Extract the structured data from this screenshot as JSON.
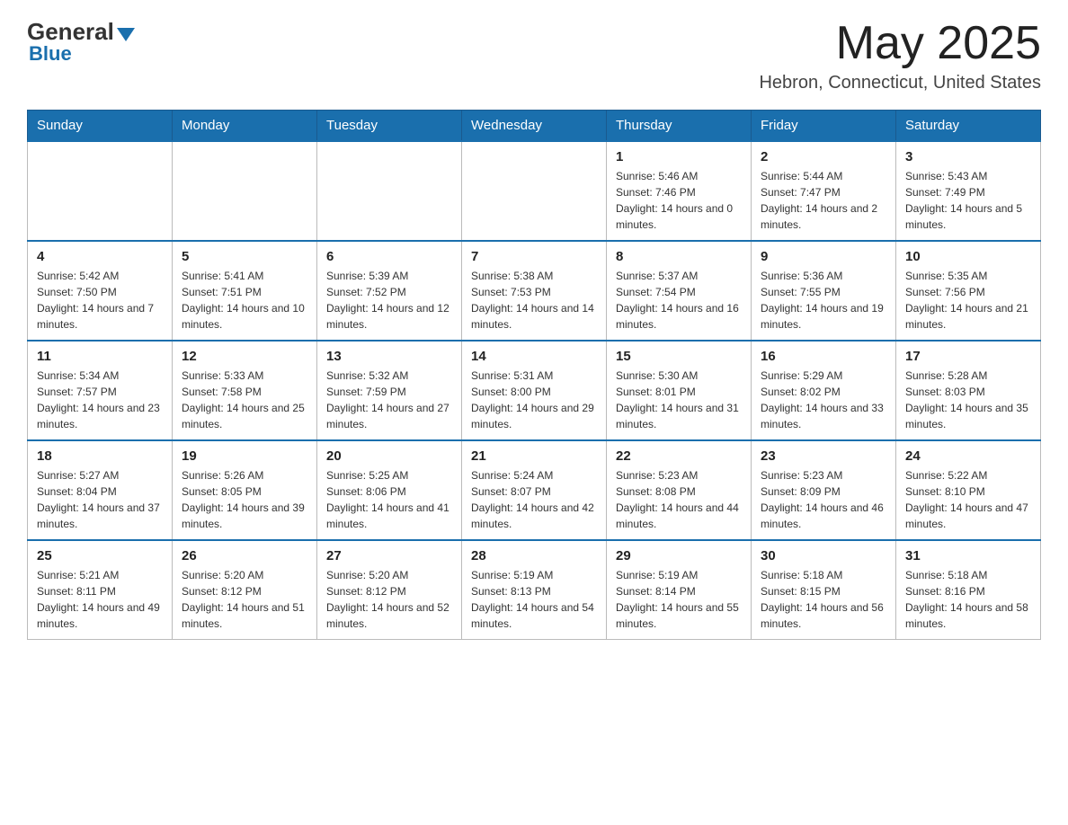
{
  "header": {
    "logo_general": "General",
    "logo_blue": "Blue",
    "logo_subtext": "Blue",
    "title": "May 2025",
    "subtitle": "Hebron, Connecticut, United States"
  },
  "calendar": {
    "days_of_week": [
      "Sunday",
      "Monday",
      "Tuesday",
      "Wednesday",
      "Thursday",
      "Friday",
      "Saturday"
    ],
    "weeks": [
      [
        {
          "day": "",
          "sunrise": "",
          "sunset": "",
          "daylight": ""
        },
        {
          "day": "",
          "sunrise": "",
          "sunset": "",
          "daylight": ""
        },
        {
          "day": "",
          "sunrise": "",
          "sunset": "",
          "daylight": ""
        },
        {
          "day": "",
          "sunrise": "",
          "sunset": "",
          "daylight": ""
        },
        {
          "day": "1",
          "sunrise": "Sunrise: 5:46 AM",
          "sunset": "Sunset: 7:46 PM",
          "daylight": "Daylight: 14 hours and 0 minutes."
        },
        {
          "day": "2",
          "sunrise": "Sunrise: 5:44 AM",
          "sunset": "Sunset: 7:47 PM",
          "daylight": "Daylight: 14 hours and 2 minutes."
        },
        {
          "day": "3",
          "sunrise": "Sunrise: 5:43 AM",
          "sunset": "Sunset: 7:49 PM",
          "daylight": "Daylight: 14 hours and 5 minutes."
        }
      ],
      [
        {
          "day": "4",
          "sunrise": "Sunrise: 5:42 AM",
          "sunset": "Sunset: 7:50 PM",
          "daylight": "Daylight: 14 hours and 7 minutes."
        },
        {
          "day": "5",
          "sunrise": "Sunrise: 5:41 AM",
          "sunset": "Sunset: 7:51 PM",
          "daylight": "Daylight: 14 hours and 10 minutes."
        },
        {
          "day": "6",
          "sunrise": "Sunrise: 5:39 AM",
          "sunset": "Sunset: 7:52 PM",
          "daylight": "Daylight: 14 hours and 12 minutes."
        },
        {
          "day": "7",
          "sunrise": "Sunrise: 5:38 AM",
          "sunset": "Sunset: 7:53 PM",
          "daylight": "Daylight: 14 hours and 14 minutes."
        },
        {
          "day": "8",
          "sunrise": "Sunrise: 5:37 AM",
          "sunset": "Sunset: 7:54 PM",
          "daylight": "Daylight: 14 hours and 16 minutes."
        },
        {
          "day": "9",
          "sunrise": "Sunrise: 5:36 AM",
          "sunset": "Sunset: 7:55 PM",
          "daylight": "Daylight: 14 hours and 19 minutes."
        },
        {
          "day": "10",
          "sunrise": "Sunrise: 5:35 AM",
          "sunset": "Sunset: 7:56 PM",
          "daylight": "Daylight: 14 hours and 21 minutes."
        }
      ],
      [
        {
          "day": "11",
          "sunrise": "Sunrise: 5:34 AM",
          "sunset": "Sunset: 7:57 PM",
          "daylight": "Daylight: 14 hours and 23 minutes."
        },
        {
          "day": "12",
          "sunrise": "Sunrise: 5:33 AM",
          "sunset": "Sunset: 7:58 PM",
          "daylight": "Daylight: 14 hours and 25 minutes."
        },
        {
          "day": "13",
          "sunrise": "Sunrise: 5:32 AM",
          "sunset": "Sunset: 7:59 PM",
          "daylight": "Daylight: 14 hours and 27 minutes."
        },
        {
          "day": "14",
          "sunrise": "Sunrise: 5:31 AM",
          "sunset": "Sunset: 8:00 PM",
          "daylight": "Daylight: 14 hours and 29 minutes."
        },
        {
          "day": "15",
          "sunrise": "Sunrise: 5:30 AM",
          "sunset": "Sunset: 8:01 PM",
          "daylight": "Daylight: 14 hours and 31 minutes."
        },
        {
          "day": "16",
          "sunrise": "Sunrise: 5:29 AM",
          "sunset": "Sunset: 8:02 PM",
          "daylight": "Daylight: 14 hours and 33 minutes."
        },
        {
          "day": "17",
          "sunrise": "Sunrise: 5:28 AM",
          "sunset": "Sunset: 8:03 PM",
          "daylight": "Daylight: 14 hours and 35 minutes."
        }
      ],
      [
        {
          "day": "18",
          "sunrise": "Sunrise: 5:27 AM",
          "sunset": "Sunset: 8:04 PM",
          "daylight": "Daylight: 14 hours and 37 minutes."
        },
        {
          "day": "19",
          "sunrise": "Sunrise: 5:26 AM",
          "sunset": "Sunset: 8:05 PM",
          "daylight": "Daylight: 14 hours and 39 minutes."
        },
        {
          "day": "20",
          "sunrise": "Sunrise: 5:25 AM",
          "sunset": "Sunset: 8:06 PM",
          "daylight": "Daylight: 14 hours and 41 minutes."
        },
        {
          "day": "21",
          "sunrise": "Sunrise: 5:24 AM",
          "sunset": "Sunset: 8:07 PM",
          "daylight": "Daylight: 14 hours and 42 minutes."
        },
        {
          "day": "22",
          "sunrise": "Sunrise: 5:23 AM",
          "sunset": "Sunset: 8:08 PM",
          "daylight": "Daylight: 14 hours and 44 minutes."
        },
        {
          "day": "23",
          "sunrise": "Sunrise: 5:23 AM",
          "sunset": "Sunset: 8:09 PM",
          "daylight": "Daylight: 14 hours and 46 minutes."
        },
        {
          "day": "24",
          "sunrise": "Sunrise: 5:22 AM",
          "sunset": "Sunset: 8:10 PM",
          "daylight": "Daylight: 14 hours and 47 minutes."
        }
      ],
      [
        {
          "day": "25",
          "sunrise": "Sunrise: 5:21 AM",
          "sunset": "Sunset: 8:11 PM",
          "daylight": "Daylight: 14 hours and 49 minutes."
        },
        {
          "day": "26",
          "sunrise": "Sunrise: 5:20 AM",
          "sunset": "Sunset: 8:12 PM",
          "daylight": "Daylight: 14 hours and 51 minutes."
        },
        {
          "day": "27",
          "sunrise": "Sunrise: 5:20 AM",
          "sunset": "Sunset: 8:12 PM",
          "daylight": "Daylight: 14 hours and 52 minutes."
        },
        {
          "day": "28",
          "sunrise": "Sunrise: 5:19 AM",
          "sunset": "Sunset: 8:13 PM",
          "daylight": "Daylight: 14 hours and 54 minutes."
        },
        {
          "day": "29",
          "sunrise": "Sunrise: 5:19 AM",
          "sunset": "Sunset: 8:14 PM",
          "daylight": "Daylight: 14 hours and 55 minutes."
        },
        {
          "day": "30",
          "sunrise": "Sunrise: 5:18 AM",
          "sunset": "Sunset: 8:15 PM",
          "daylight": "Daylight: 14 hours and 56 minutes."
        },
        {
          "day": "31",
          "sunrise": "Sunrise: 5:18 AM",
          "sunset": "Sunset: 8:16 PM",
          "daylight": "Daylight: 14 hours and 58 minutes."
        }
      ]
    ]
  }
}
